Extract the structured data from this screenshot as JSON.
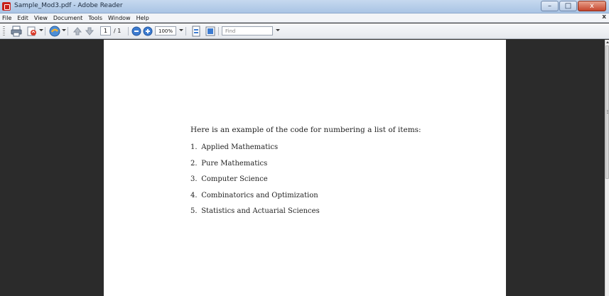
{
  "window": {
    "title": "Sample_Mod3.pdf - Adobe Reader",
    "controls": {
      "minimize": "–",
      "maximize": "□",
      "close": "x"
    }
  },
  "menu": {
    "items": [
      "File",
      "Edit",
      "View",
      "Document",
      "Tools",
      "Window",
      "Help"
    ],
    "close_glyph": "x"
  },
  "toolbar": {
    "icons": [
      "print-icon",
      "create-pdf-icon",
      "collaborate-icon",
      "previous-page-icon",
      "next-page-icon",
      "zoom-out-icon",
      "zoom-in-icon",
      "fit-page-icon",
      "fit-width-icon"
    ],
    "page_number": "1",
    "page_total": "/ 1",
    "zoom": "100%",
    "find_placeholder": "Find"
  },
  "document": {
    "intro": "Here is an example of the code for numbering a list of items:",
    "items": [
      {
        "num": "1.",
        "text": "Applied Mathematics"
      },
      {
        "num": "2.",
        "text": "Pure Mathematics"
      },
      {
        "num": "3.",
        "text": "Computer Science"
      },
      {
        "num": "4.",
        "text": "Combinatorics and Optimization"
      },
      {
        "num": "5.",
        "text": "Statistics and Actuarial Sciences"
      }
    ]
  },
  "colors": {
    "background": "#2b2b2b",
    "page": "#ffffff",
    "titlebar": "#b5cbe6",
    "close_button": "#c5452d"
  }
}
